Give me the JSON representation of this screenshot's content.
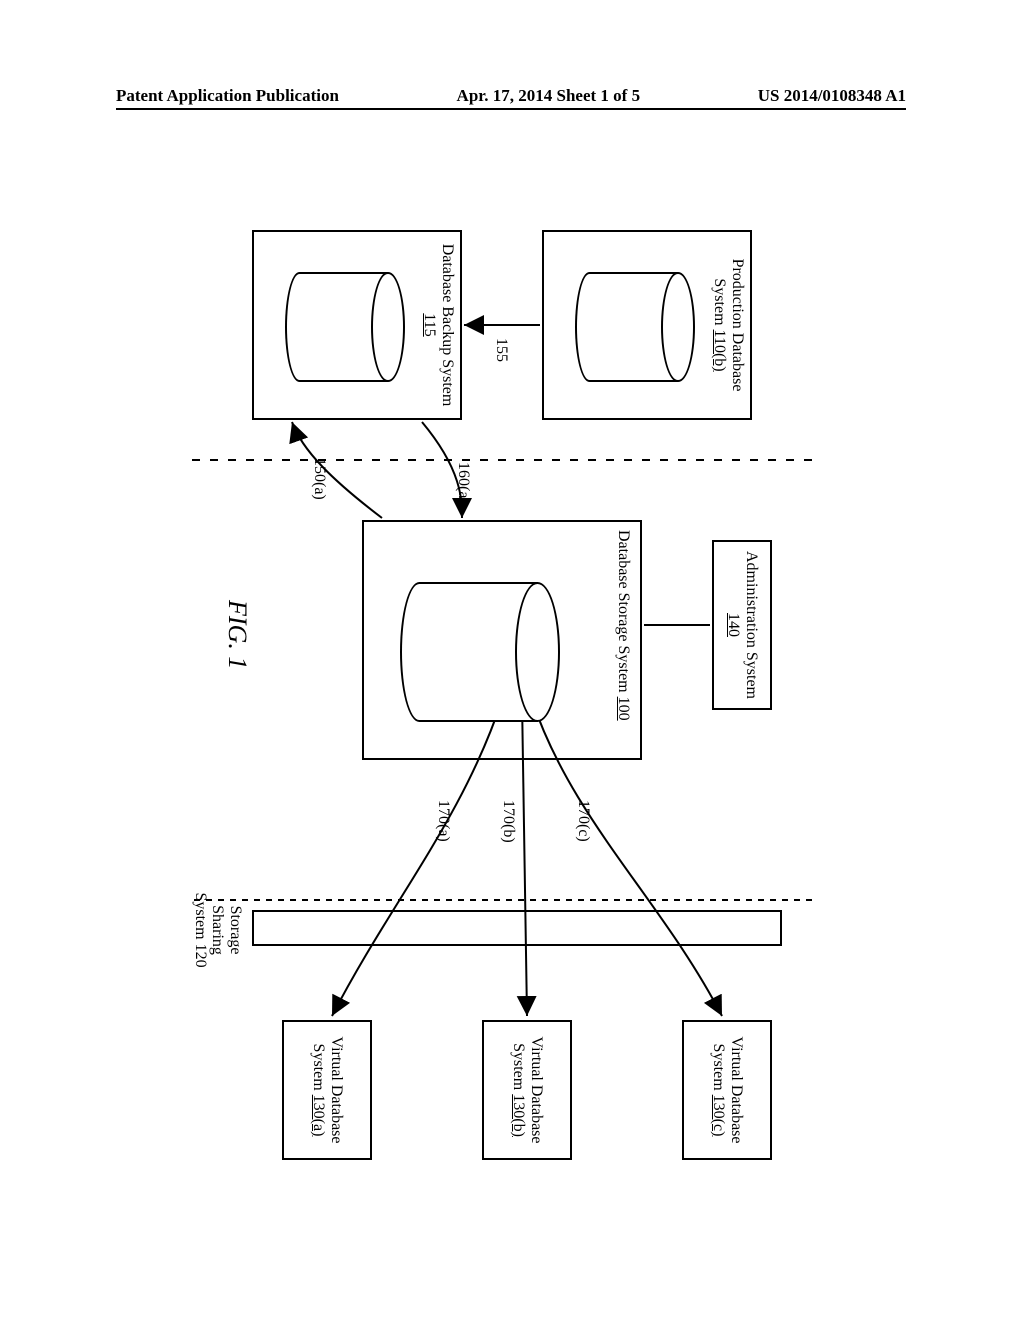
{
  "header": {
    "left": "Patent Application Publication",
    "center": "Apr. 17, 2014  Sheet 1 of 5",
    "right": "US 2014/0108348 A1"
  },
  "figure_label": "FIG. 1",
  "blocks": {
    "prod_db": {
      "title": "Production Database System",
      "num": "110(b)"
    },
    "db_backup": {
      "title": "Database Backup System",
      "num": "115"
    },
    "admin": {
      "title": "Administration System",
      "num": "140"
    },
    "storage": {
      "title": "Database Storage System",
      "num": "100"
    },
    "sss": {
      "title": "Storage Sharing System",
      "num": "120"
    },
    "vdb_a": {
      "title": "Virtual Database System",
      "num": "130(a)"
    },
    "vdb_b": {
      "title": "Virtual Database System",
      "num": "130(b)"
    },
    "vdb_c": {
      "title": "Virtual Database System",
      "num": "130(c)"
    }
  },
  "edge_labels": {
    "e155": "155",
    "e160a": "160(a)",
    "e150a": "150(a)",
    "e170a": "170(a)",
    "e170b": "170(b)",
    "e170c": "170(c)"
  }
}
